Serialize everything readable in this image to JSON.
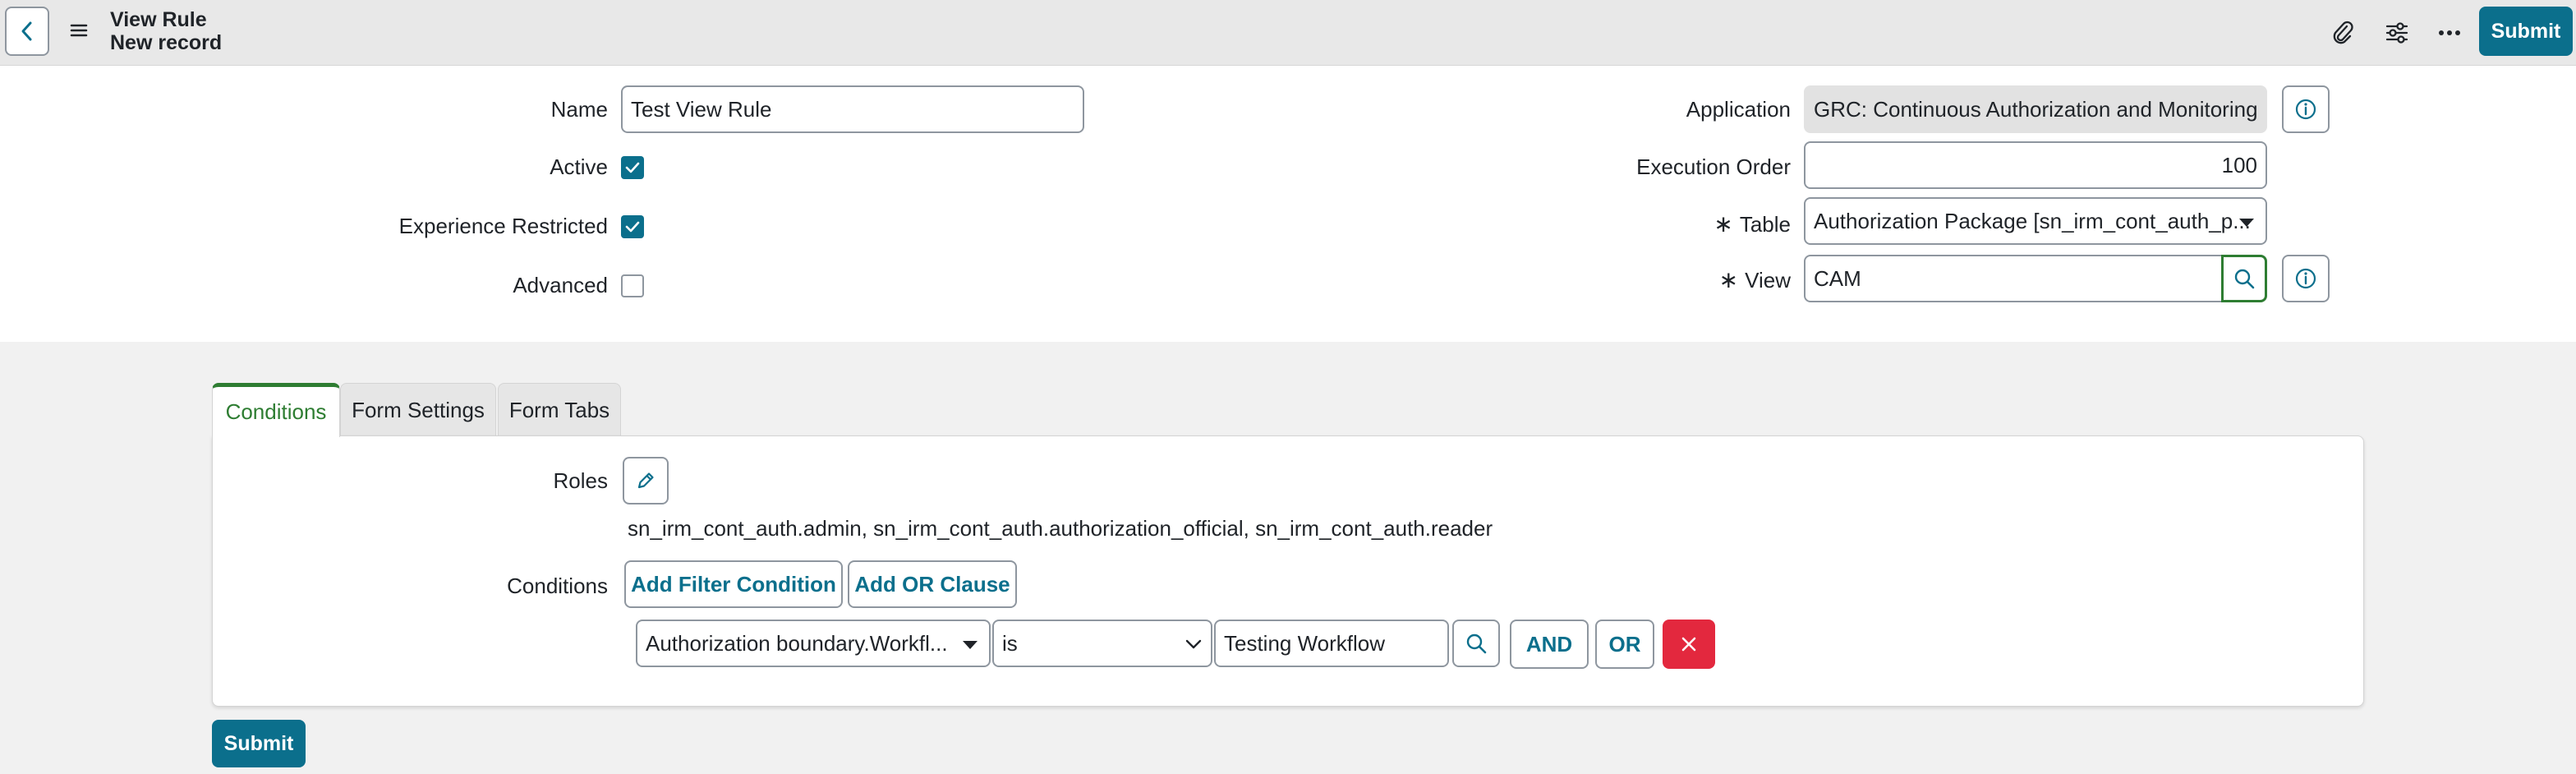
{
  "header": {
    "title": "View Rule",
    "subtitle": "New record",
    "submit_label": "Submit",
    "icons": [
      "back-icon",
      "menu-icon",
      "attachment-icon",
      "settings-sliders-icon",
      "more-icon"
    ]
  },
  "form": {
    "name_label": "Name",
    "name_value": "Test View Rule",
    "active_label": "Active",
    "active_checked": true,
    "experience_restricted_label": "Experience Restricted",
    "experience_restricted_checked": true,
    "advanced_label": "Advanced",
    "advanced_checked": false,
    "application_label": "Application",
    "application_value": "GRC: Continuous Authorization and Monitoring",
    "execution_order_label": "Execution Order",
    "execution_order_value": "100",
    "table_label": "Table",
    "table_value": "Authorization Package [sn_irm_cont_auth_p...",
    "view_label": "View",
    "view_value": "CAM",
    "required_marker": "∗"
  },
  "tabs": [
    {
      "label": "Conditions",
      "active": true
    },
    {
      "label": "Form Settings",
      "active": false
    },
    {
      "label": "Form Tabs",
      "active": false
    }
  ],
  "conditions_panel": {
    "roles_label": "Roles",
    "roles_value": "sn_irm_cont_auth.admin, sn_irm_cont_auth.authorization_official, sn_irm_cont_auth.reader",
    "conditions_label": "Conditions",
    "add_filter_label": "Add Filter Condition",
    "add_or_label": "Add OR Clause",
    "filter_field": "Authorization boundary.Workfl...",
    "filter_operator": "is",
    "filter_value": "Testing Workflow",
    "and_label": "AND",
    "or_label": "OR"
  },
  "footer": {
    "submit_label": "Submit"
  },
  "colors": {
    "primary": "#0b6f8c",
    "active_tab": "#2e7d32",
    "danger": "#e3283e",
    "header_bg": "#e8e8e8"
  }
}
